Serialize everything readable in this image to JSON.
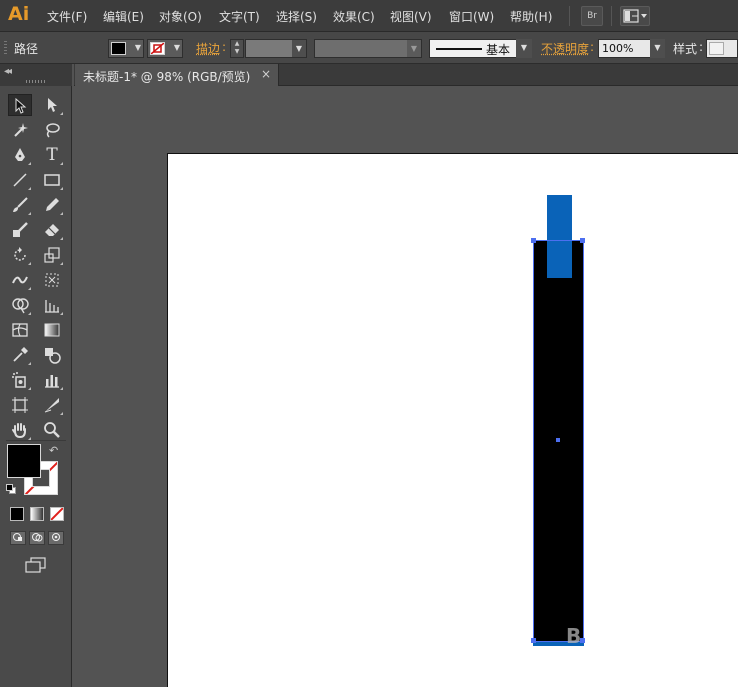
{
  "app": {
    "logo_text": "Ai"
  },
  "menu": {
    "items": [
      "文件(F)",
      "编辑(E)",
      "对象(O)",
      "文字(T)",
      "选择(S)",
      "效果(C)",
      "视图(V)",
      "窗口(W)",
      "帮助(H)"
    ],
    "bridge_label": "Br"
  },
  "control_bar": {
    "selection_type": "路径",
    "fill_color": "#000000",
    "stroke_color": "none",
    "stroke_label": "描边",
    "stroke_weight": "",
    "variable_width": "",
    "stroke_style": "基本",
    "opacity_label": "不透明度",
    "opacity_value": "100%",
    "style_label": "样式"
  },
  "document_tab": {
    "title": "未标题-1* @ 98% (RGB/预览)",
    "close_glyph": "×"
  },
  "tools": {
    "swap_glyph": "↶"
  },
  "artwork": {
    "body_color": "#000000",
    "accent_color": "#0a63b8",
    "selection_color": "#4d6ff0",
    "watermark_text": "B"
  }
}
